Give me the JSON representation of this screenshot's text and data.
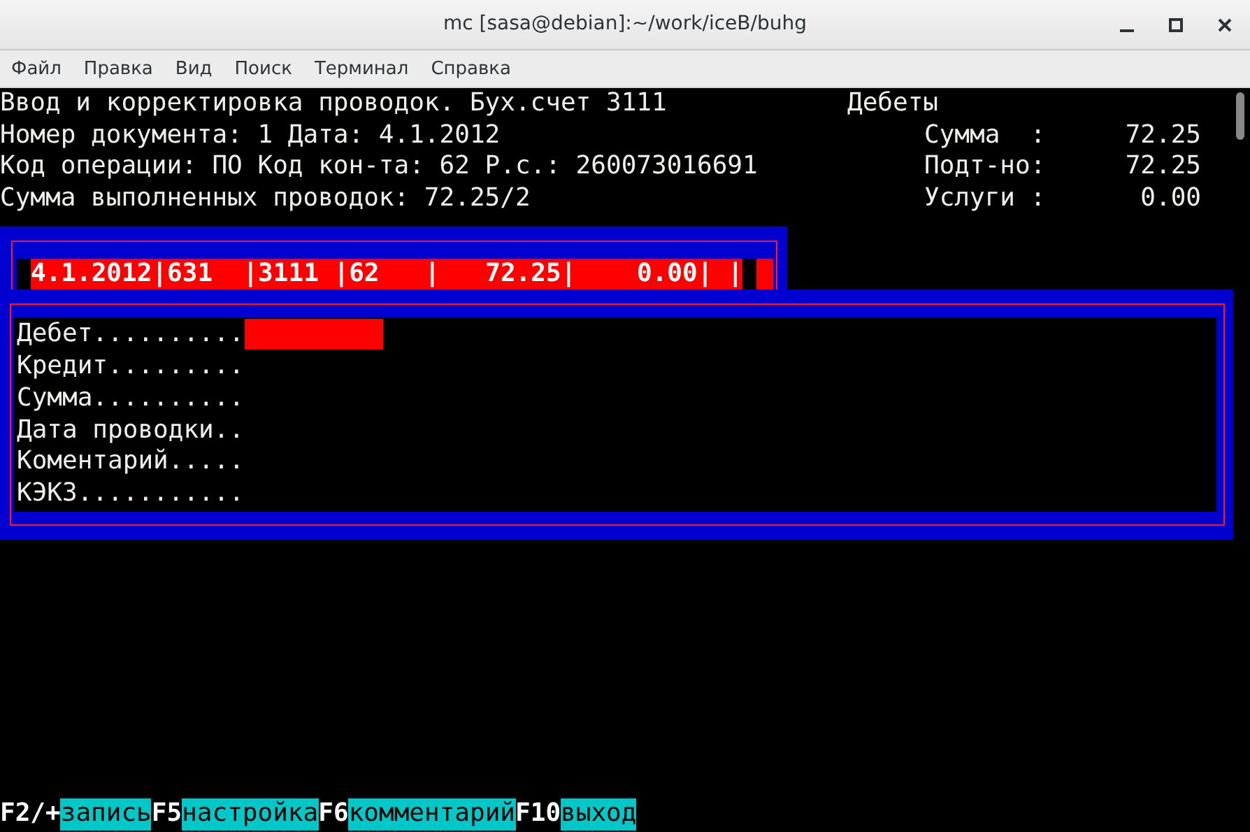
{
  "window": {
    "title": "mc [sasa@debian]:~/work/iceB/buhg"
  },
  "menu": [
    "Файл",
    "Правка",
    "Вид",
    "Поиск",
    "Терминал",
    "Справка"
  ],
  "header": {
    "lines": [
      "Ввод и корректировка проводок. Бух.счет 3111",
      "Номер документа: 1 Дата: 4.1.2012",
      "Код операции: ПО Код кон-та: 62 Р.с.: 260073016691",
      "Сумма выполненных проводок: 72.25/2"
    ]
  },
  "summary": {
    "title": "Дебеты",
    "rows": [
      {
        "label": "Сумма  :",
        "value": "72.25"
      },
      {
        "label": "Подт-но:",
        "value": "72.25"
      },
      {
        "label": "Услуги :",
        "value": "0.00"
      }
    ]
  },
  "record": {
    "text": "4.1.2012|631  |3111 |62   |   72.25|    0.00| |",
    "selected": true
  },
  "form": {
    "fields": [
      {
        "label": "Дебет..........",
        "focused": true
      },
      {
        "label": "Кредит.........",
        "focused": false
      },
      {
        "label": "Сумма..........",
        "focused": false
      },
      {
        "label": "Дата проводки..",
        "focused": false
      },
      {
        "label": "Коментарий.....",
        "focused": false
      },
      {
        "label": "КЭКЗ...........",
        "focused": false
      }
    ]
  },
  "function_keys": [
    {
      "key": "F2/+",
      "action": "запись"
    },
    {
      "key": "F5",
      "action": "настройка"
    },
    {
      "key": "F6",
      "action": "комментарий"
    },
    {
      "key": "F10",
      "action": "выход"
    }
  ]
}
